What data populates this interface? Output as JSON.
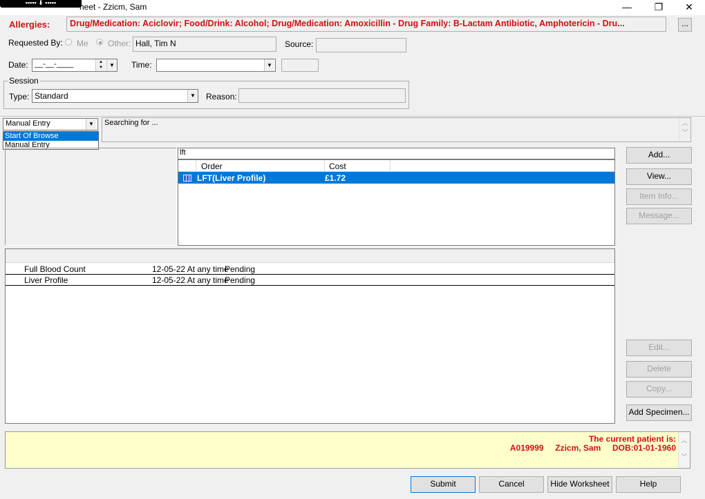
{
  "window": {
    "title": "heet - Zzicm, Sam",
    "minimize": "—",
    "restore": "❐",
    "close": "✕"
  },
  "overlay": {
    "label": "▪▪▪▪▪ ⬇ ▪▪▪▪▪"
  },
  "allergies": {
    "label": "Allergies:",
    "text": "Drug/Medication: Aciclovir; Food/Drink: Alcohol; Drug/Medication: Amoxicillin - Drug Family: B-Lactam Antibiotic, Amphotericin - Dru...",
    "more_button": "..."
  },
  "requested_by": {
    "label": "Requested By:",
    "me": "Me",
    "other": "Other:",
    "value": "Hall, Tim N"
  },
  "source": {
    "label": "Source:",
    "value": ""
  },
  "date": {
    "label": "Date:",
    "value": "__-__-____"
  },
  "time": {
    "label": "Time:",
    "value": ""
  },
  "session": {
    "legend": "Session",
    "type_label": "Type:",
    "type_value": "Standard",
    "reason_label": "Reason:",
    "reason_value": ""
  },
  "mode_dropdown": {
    "selected": "Manual Entry",
    "options": [
      "Start Of Browse",
      "Manual Entry"
    ]
  },
  "searching": {
    "text": "Searching for ..."
  },
  "search_input": {
    "value": "lft"
  },
  "order_table": {
    "columns": [
      "Order",
      "Cost"
    ],
    "rows": [
      {
        "order": "LFT(Liver Profile)",
        "cost": "£1.72"
      }
    ]
  },
  "side_buttons": {
    "add": "Add...",
    "view": "View...",
    "item_info": "Item Info...",
    "message": "Message..."
  },
  "selected_orders": [
    {
      "name": "Full Blood Count",
      "when": "12-05-22 At any time",
      "status": "Pending"
    },
    {
      "name": "Liver Profile",
      "when": "12-05-22 At any time",
      "status": "Pending"
    }
  ],
  "lower_buttons": {
    "edit": "Edit...",
    "delete": "Delete",
    "copy": "Copy...",
    "add_specimen": "Add Specimen..."
  },
  "patient_info": {
    "heading": "The current patient is:",
    "id": "A019999",
    "name": "Zzicm, Sam",
    "dob": "DOB:01-01-1960"
  },
  "footer_buttons": {
    "submit": "Submit",
    "cancel": "Cancel",
    "hide_worksheet": "Hide Worksheet",
    "help": "Help"
  }
}
